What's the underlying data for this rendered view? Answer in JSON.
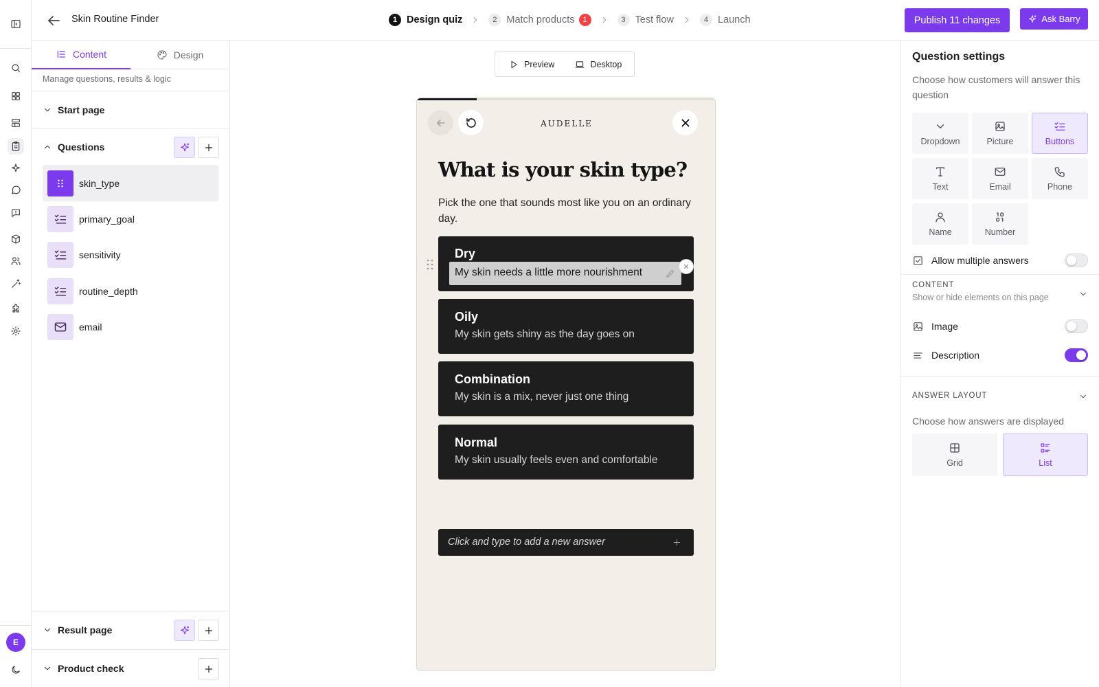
{
  "app": {
    "title": "Skin Routine Finder",
    "accent_color": "#7c3aed",
    "avatar_initial": "E"
  },
  "steps": [
    {
      "num": "1",
      "label": "Design quiz",
      "active": true
    },
    {
      "num": "2",
      "label": "Match products",
      "badge": "1"
    },
    {
      "num": "3",
      "label": "Test flow"
    },
    {
      "num": "4",
      "label": "Launch"
    }
  ],
  "header": {
    "publish_label": "Publish 11 changes",
    "ask_label": "Ask Barry"
  },
  "left": {
    "tabs": [
      {
        "label": "Content",
        "active": true
      },
      {
        "label": "Design"
      }
    ],
    "subtitle": "Manage questions, results & logic",
    "sections": {
      "start": "Start page",
      "questions": "Questions",
      "result": "Result page",
      "product": "Product check"
    },
    "questions": [
      {
        "label": "skin_type",
        "icon": "drag-grip-icon",
        "selected": true
      },
      {
        "label": "primary_goal",
        "icon": "checklist-icon"
      },
      {
        "label": "sensitivity",
        "icon": "checklist-icon"
      },
      {
        "label": "routine_depth",
        "icon": "checklist-icon"
      },
      {
        "label": "email",
        "icon": "mail-icon"
      }
    ]
  },
  "canvas": {
    "preview_label": "Preview",
    "device_label": "Desktop",
    "progress": 0.2,
    "brand": "AUDELLE",
    "question": "What is your skin type?",
    "description": "Pick the one that sounds most like you on an ordinary day.",
    "answers": [
      {
        "title": "Dry",
        "desc": "My skin needs a little more nourishment",
        "editing": true
      },
      {
        "title": "Oily",
        "desc": "My skin gets shiny as the day goes on"
      },
      {
        "title": "Combination",
        "desc": "My skin is a mix, never just one thing"
      },
      {
        "title": "Normal",
        "desc": "My skin usually feels even and comfortable"
      }
    ],
    "add_answer_placeholder": "Click and type to add a new answer"
  },
  "right": {
    "title": "Question settings",
    "subtitle": "Choose how customers will answer this question",
    "answer_types": [
      {
        "label": "Dropdown",
        "icon": "chevron-down-icon"
      },
      {
        "label": "Picture",
        "icon": "image-icon"
      },
      {
        "label": "Buttons",
        "icon": "checklist-icon",
        "selected": true
      },
      {
        "label": "Text",
        "icon": "text-icon"
      },
      {
        "label": "Email",
        "icon": "mail-icon"
      },
      {
        "label": "Phone",
        "icon": "phone-icon"
      },
      {
        "label": "Name",
        "icon": "user-icon"
      },
      {
        "label": "Number",
        "icon": "number-icon"
      }
    ],
    "allow_multiple": {
      "label": "Allow multiple answers",
      "on": false
    },
    "content": {
      "caption": "CONTENT",
      "sub": "Show or hide elements on this page",
      "image": {
        "label": "Image",
        "on": false
      },
      "description": {
        "label": "Description",
        "on": true
      }
    },
    "layout": {
      "caption": "ANSWER LAYOUT",
      "sub": "Choose how answers are displayed",
      "options": [
        {
          "label": "Grid"
        },
        {
          "label": "List",
          "selected": true
        }
      ]
    }
  }
}
